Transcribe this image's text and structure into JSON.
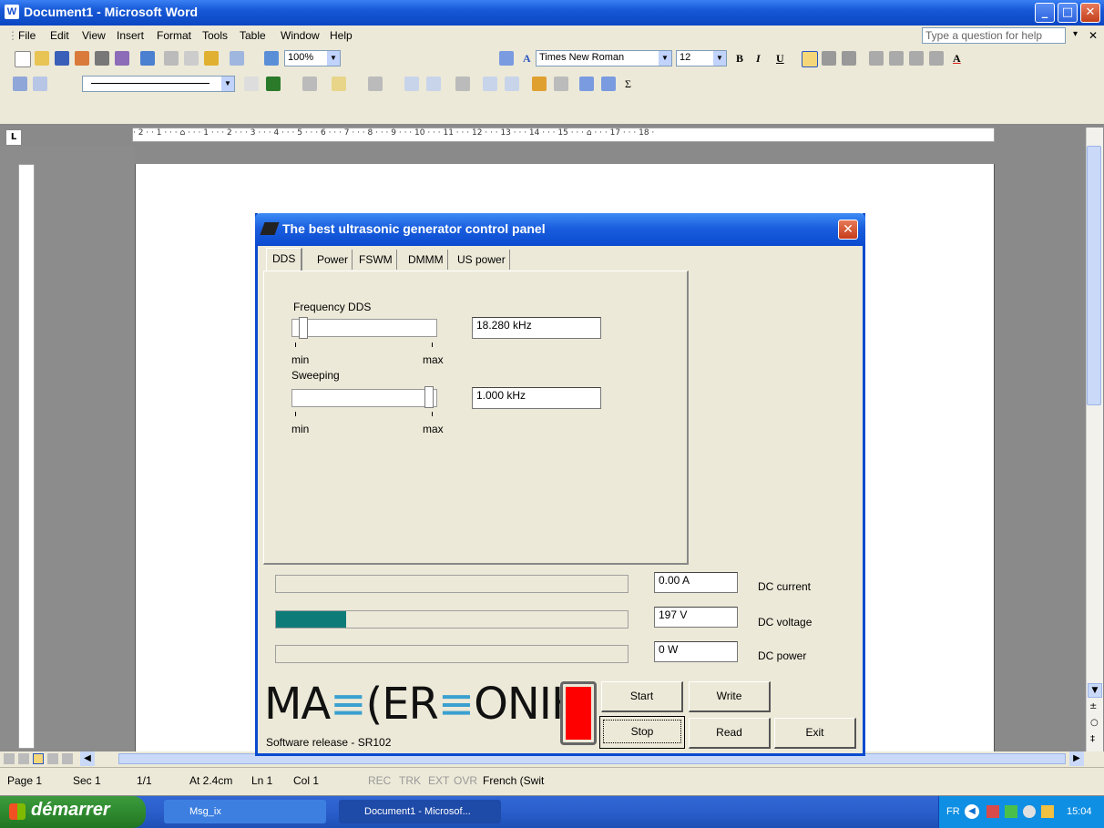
{
  "window": {
    "title": "Document1 - Microsoft Word"
  },
  "menu": [
    "File",
    "Edit",
    "View",
    "Insert",
    "Format",
    "Tools",
    "Table",
    "Window",
    "Help"
  ],
  "help_placeholder": "Type a question for help",
  "toolbar": {
    "zoom": "100%",
    "font": "Times New Roman",
    "font_size": "12",
    "bold": "B",
    "italic": "I",
    "underline": "U",
    "font_color": "A"
  },
  "ruler_text": "· 2 · · 1 · · · ⌂ · · · 1 · · · 2 · · · 3 · · · 4 · · · 5 · · · 6 · · · 7 · · · 8 · · · 9 · · · 10 · · · 11 · · · 12 · · · 13 · · · 14 · · · 15 · · · ⌂ · · · 17 · · · 18 ·",
  "dialog": {
    "title": "The best ultrasonic generator control panel",
    "tabs": [
      "DDS",
      "Power",
      "FSWM",
      "DMMM",
      "US power"
    ],
    "active_tab": "DDS",
    "freq": {
      "label": "Frequency DDS",
      "value": "18.280 kHz",
      "min": "min",
      "max": "max",
      "level": 0.05
    },
    "sweep": {
      "label": "Sweeping",
      "value": "1.000 kHz",
      "min": "min",
      "max": "max",
      "level": 0.97
    },
    "meters": [
      {
        "value": "0.00 A",
        "label": "DC current",
        "fill": 0.0
      },
      {
        "value": "197 V",
        "label": "DC voltage",
        "fill": 0.2
      },
      {
        "value": "0 W",
        "label": "DC power",
        "fill": 0.0
      }
    ],
    "logo": "MASTERSONIK",
    "release": "Software release - SR102",
    "buttons": {
      "start": "Start",
      "write": "Write",
      "stop": "Stop",
      "read": "Read",
      "exit": "Exit"
    },
    "led_color": "#ff0000"
  },
  "status": {
    "page": "Page 1",
    "sec": "Sec 1",
    "pages": "1/1",
    "at": "At 2.4cm",
    "ln": "Ln 1",
    "col": "Col 1",
    "rec": "REC",
    "trk": "TRK",
    "ext": "EXT",
    "ovr": "OVR",
    "lang": "French (Swit"
  },
  "taskbar": {
    "start": "démarrer",
    "tasks": [
      "Msg_ix",
      "Document1 - Microsof..."
    ],
    "lang": "FR",
    "time": "15:04"
  }
}
